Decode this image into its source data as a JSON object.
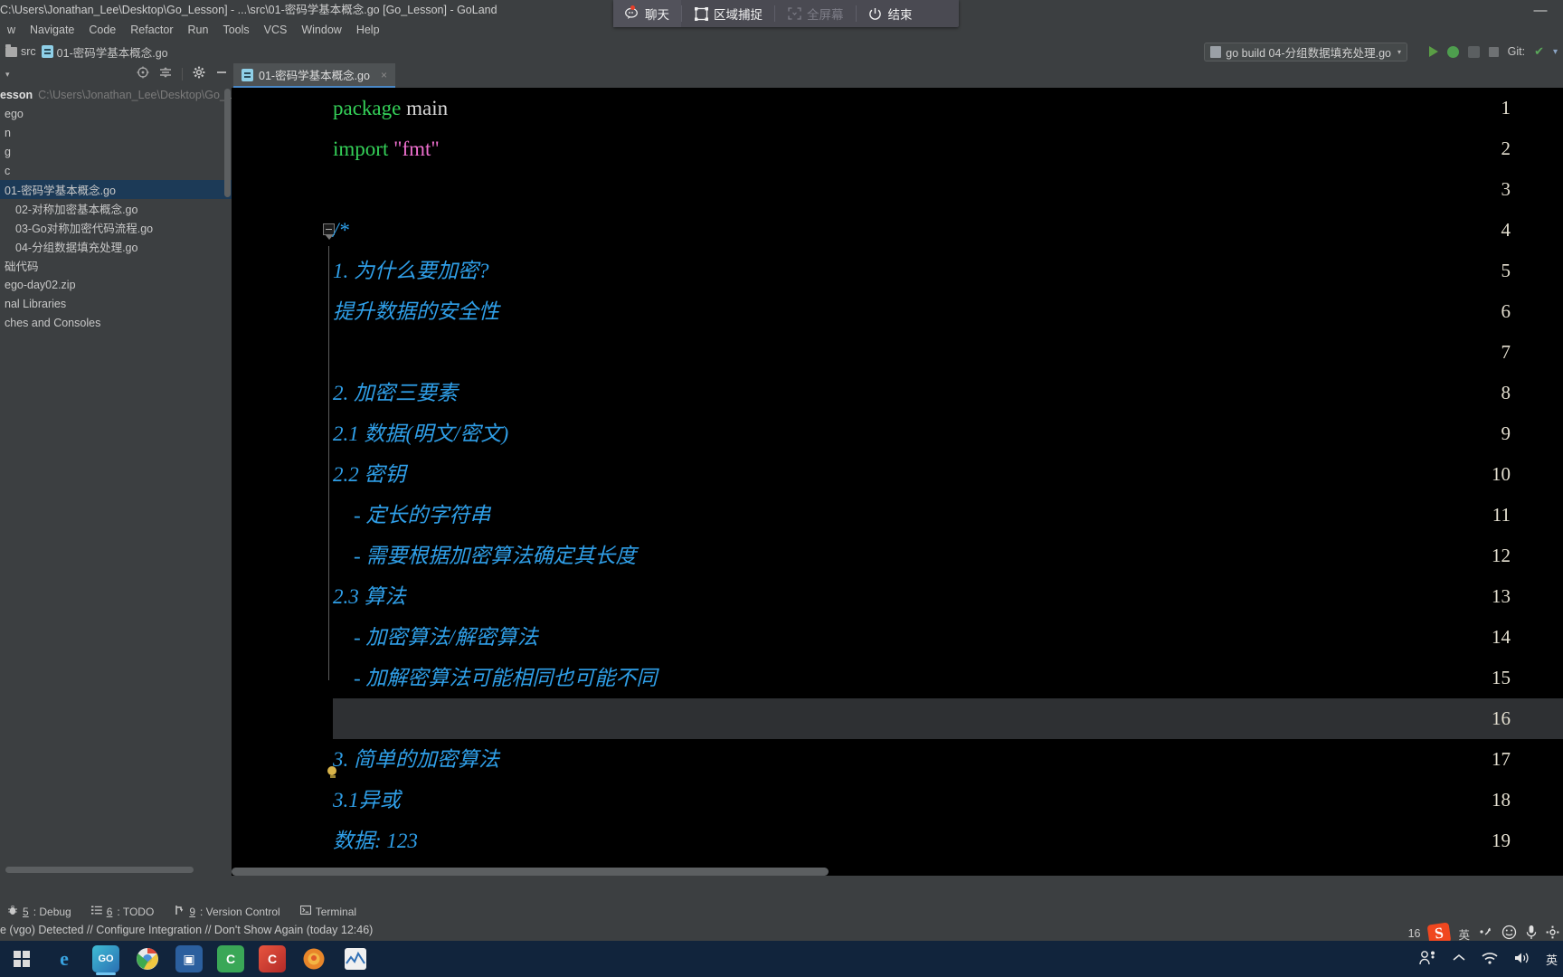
{
  "window": {
    "title": "C:\\Users\\Jonathan_Lee\\Desktop\\Go_Lesson] - ...\\src\\01-密码学基本概念.go [Go_Lesson] - GoLand",
    "minimize_glyph": "—"
  },
  "capture_toolbar": {
    "items": [
      {
        "label": "聊天",
        "icon": "chat-bubble-icon",
        "state": "active"
      },
      {
        "label": "区域捕捉",
        "icon": "crop-frame-icon",
        "state": "normal"
      },
      {
        "label": "全屏幕",
        "icon": "fullscreen-icon",
        "state": "disabled"
      },
      {
        "label": "结束",
        "icon": "power-icon",
        "state": "normal"
      }
    ]
  },
  "menubar": {
    "items": [
      "w",
      "Navigate",
      "Code",
      "Refactor",
      "Run",
      "Tools",
      "VCS",
      "Window",
      "Help"
    ]
  },
  "breadcrumb": {
    "items": [
      {
        "label": "src",
        "icon": "folder-icon"
      },
      {
        "label": "01-密码学基本概念.go",
        "icon": "go-file-icon"
      }
    ]
  },
  "toolbar": {
    "run_config": "go build 04-分组数据填充处理.go",
    "run_config_caret": "▾",
    "git_label": "Git:",
    "git_check": "✔",
    "git_caret": "▾"
  },
  "project_panel": {
    "caret": "▾",
    "tools": [
      "target-icon",
      "collapse-all-icon",
      "settings-gear-icon",
      "minimize-icon"
    ],
    "root": {
      "name": "esson",
      "path": "C:\\Users\\Jonathan_Lee\\Desktop\\Go_L"
    },
    "tree": [
      {
        "label": "ego",
        "indent": 0,
        "selected": false
      },
      {
        "label": "n",
        "indent": 0,
        "selected": false
      },
      {
        "label": "g",
        "indent": 0,
        "selected": false
      },
      {
        "label": "c",
        "indent": 0,
        "selected": false
      },
      {
        "label": "01-密码学基本概念.go",
        "indent": 0,
        "selected": true
      },
      {
        "label": "02-对称加密基本概念.go",
        "indent": 1,
        "selected": false
      },
      {
        "label": "03-Go对称加密代码流程.go",
        "indent": 1,
        "selected": false
      },
      {
        "label": "04-分组数据填充处理.go",
        "indent": 1,
        "selected": false
      },
      {
        "label": "础代码",
        "indent": 0,
        "selected": false
      },
      {
        "label": "ego-day02.zip",
        "indent": 0,
        "selected": false
      },
      {
        "label": "nal Libraries",
        "indent": 0,
        "selected": false
      },
      {
        "label": "ches and Consoles",
        "indent": 0,
        "selected": false
      }
    ]
  },
  "editor": {
    "tab": {
      "label": "01-密码学基本概念.go",
      "icon": "go-file-icon",
      "close": "×"
    },
    "highlighted_line": 16,
    "lines": [
      {
        "n": 1,
        "segments": [
          {
            "t": "package ",
            "c": "kw"
          },
          {
            "t": "main",
            "c": "plain"
          }
        ]
      },
      {
        "n": 2,
        "segments": [
          {
            "t": "import ",
            "c": "kw"
          },
          {
            "t": "\"fmt\"",
            "c": "str"
          }
        ]
      },
      {
        "n": 3,
        "segments": []
      },
      {
        "n": 4,
        "segments": [
          {
            "t": "/*",
            "c": "cmt"
          }
        ]
      },
      {
        "n": 5,
        "segments": [
          {
            "t": "1. 为什么要加密?",
            "c": "cmt"
          }
        ]
      },
      {
        "n": 6,
        "segments": [
          {
            "t": "提升数据的安全性",
            "c": "cmt"
          }
        ]
      },
      {
        "n": 7,
        "segments": []
      },
      {
        "n": 8,
        "segments": [
          {
            "t": "2. 加密三要素",
            "c": "cmt"
          }
        ]
      },
      {
        "n": 9,
        "segments": [
          {
            "t": "2.1 数据(明文/密文)",
            "c": "cmt"
          }
        ]
      },
      {
        "n": 10,
        "segments": [
          {
            "t": "2.2 密钥",
            "c": "cmt"
          }
        ]
      },
      {
        "n": 11,
        "segments": [
          {
            "t": "    - 定长的字符串",
            "c": "cmt"
          }
        ]
      },
      {
        "n": 12,
        "segments": [
          {
            "t": "    - 需要根据加密算法确定其长度",
            "c": "cmt"
          }
        ]
      },
      {
        "n": 13,
        "segments": [
          {
            "t": "2.3 算法",
            "c": "cmt"
          }
        ]
      },
      {
        "n": 14,
        "segments": [
          {
            "t": "    - 加密算法/解密算法",
            "c": "cmt"
          }
        ]
      },
      {
        "n": 15,
        "segments": [
          {
            "t": "    - 加解密算法可能相同也可能不同",
            "c": "cmt"
          }
        ]
      },
      {
        "n": 16,
        "segments": []
      },
      {
        "n": 17,
        "segments": [
          {
            "t": "3. 简单的加密算法",
            "c": "cmt"
          }
        ]
      },
      {
        "n": 18,
        "segments": [
          {
            "t": "3.1异或",
            "c": "cmt"
          }
        ]
      },
      {
        "n": 19,
        "segments": [
          {
            "t": "数据: 123",
            "c": "cmt"
          }
        ]
      }
    ]
  },
  "tool_windows": {
    "items": [
      {
        "num": "5",
        "label": ": Debug",
        "icon": "debug-bug-icon"
      },
      {
        "num": "6",
        "label": ": TODO",
        "icon": "todo-list-icon"
      },
      {
        "num": "9",
        "label": ": Version Control",
        "icon": "branch-icon"
      },
      {
        "num": "",
        "label": "Terminal",
        "icon": "terminal-icon"
      }
    ]
  },
  "status_bar": {
    "message": "e (vgo) Detected // Configure Integration // Don't Show Again (today 12:46)",
    "line_col": "16",
    "ime": {
      "badge": "S",
      "mode": "英"
    },
    "tray_icons": [
      "sogou-icon",
      "ime-mode-icon",
      "pinyin-icon",
      "emoji-icon",
      "microphone-icon",
      "settings-icon"
    ]
  },
  "taskbar": {
    "start": {
      "label": "开始",
      "icon": "windows-start-icon"
    },
    "apps": [
      {
        "name": "edge-icon",
        "color": "#0e79be",
        "glyph": "e",
        "active": false
      },
      {
        "name": "goland-icon",
        "color": "#2d6c9c",
        "glyph": "GO",
        "active": true
      },
      {
        "name": "chrome-icon",
        "color": "#e8e8e8",
        "glyph": "◉",
        "active": false
      },
      {
        "name": "virtualbox-icon",
        "color": "#2b5f9e",
        "glyph": "▣",
        "active": false
      },
      {
        "name": "wechat-dev-icon",
        "color": "#3aa757",
        "glyph": "C",
        "active": false
      },
      {
        "name": "clion-icon",
        "color": "#cb3a34",
        "glyph": "C",
        "active": false
      },
      {
        "name": "firefox-icon",
        "color": "#e8862a",
        "glyph": "◎",
        "active": false
      },
      {
        "name": "monitor-icon",
        "color": "#2f6fb5",
        "glyph": "⌁",
        "active": false
      }
    ],
    "tray": [
      "people-icon",
      "chevron-up-icon",
      "wifi-icon",
      "volume-icon",
      "ime-icon"
    ]
  }
}
